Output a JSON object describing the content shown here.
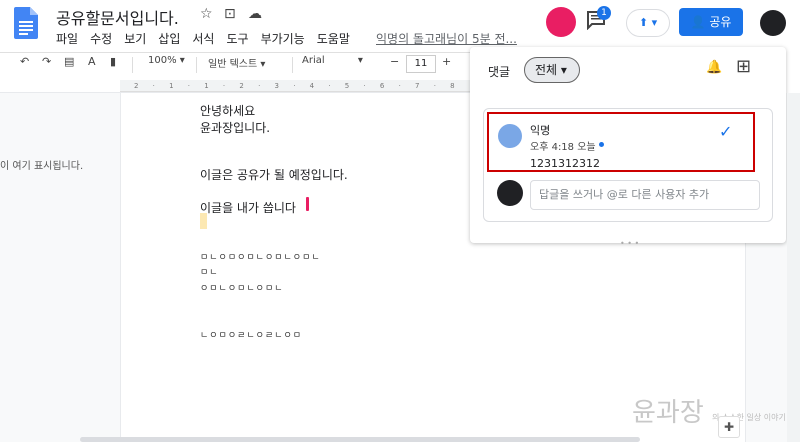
{
  "header": {
    "title": "공유할문서입니다.",
    "star_icon": "star-icon",
    "folder_icon": "move-folder-icon",
    "cloud_icon": "cloud-status-icon",
    "last_edit": "익명의 돌고래님이 5분 전..."
  },
  "menu": [
    "파일",
    "수정",
    "보기",
    "삽입",
    "서식",
    "도구",
    "부가기능",
    "도움말"
  ],
  "toolbar": {
    "zoom": "100%",
    "style": "일반 텍스트",
    "font": "Arial",
    "font_size": "11",
    "minus": "−",
    "plus": "+"
  },
  "ruler": "2 · 1 · 1 · 2 · 3 · 4 · 5 · 6 · 7 · 8",
  "sidebar_hint": "이 여기 표시됩니다.",
  "doc": {
    "line1": "안녕하세요",
    "line2": "윤과장입니다.",
    "line3": "이글은 공유가 될 예정입니다.",
    "line4": "이글을 내가 씁니다",
    "shapes1": "ㅁㄴㅇㅁㅇㅁㄴㅇㅁㄴㅇㅁㄴ",
    "shapes2": "ㅁㄴ",
    "shapes3": "ㅇㅁㄴㅇㅁㄴㅇㅁㄴ",
    "shapes4": "ㄴㅇㅁㅇㄹㄴㅇㄹㄴㅇㅁ"
  },
  "share": {
    "label": "공유",
    "icon": "person-icon"
  },
  "notifications": {
    "count": "1"
  },
  "comments": {
    "title": "댓글",
    "filter": "전체",
    "thread": {
      "author": "익명",
      "time": "오후 4:18 오늘",
      "body": "1231312312",
      "reply_placeholder": "답글을 쓰거나 @로 다른 사용자 추가"
    }
  },
  "watermark": {
    "main": "윤과장",
    "sub": "의 소소한 일상 이야기"
  },
  "colors": {
    "accent": "#1a73e8",
    "highlight_box": "#cc0000",
    "cursor": "#e91e63"
  }
}
